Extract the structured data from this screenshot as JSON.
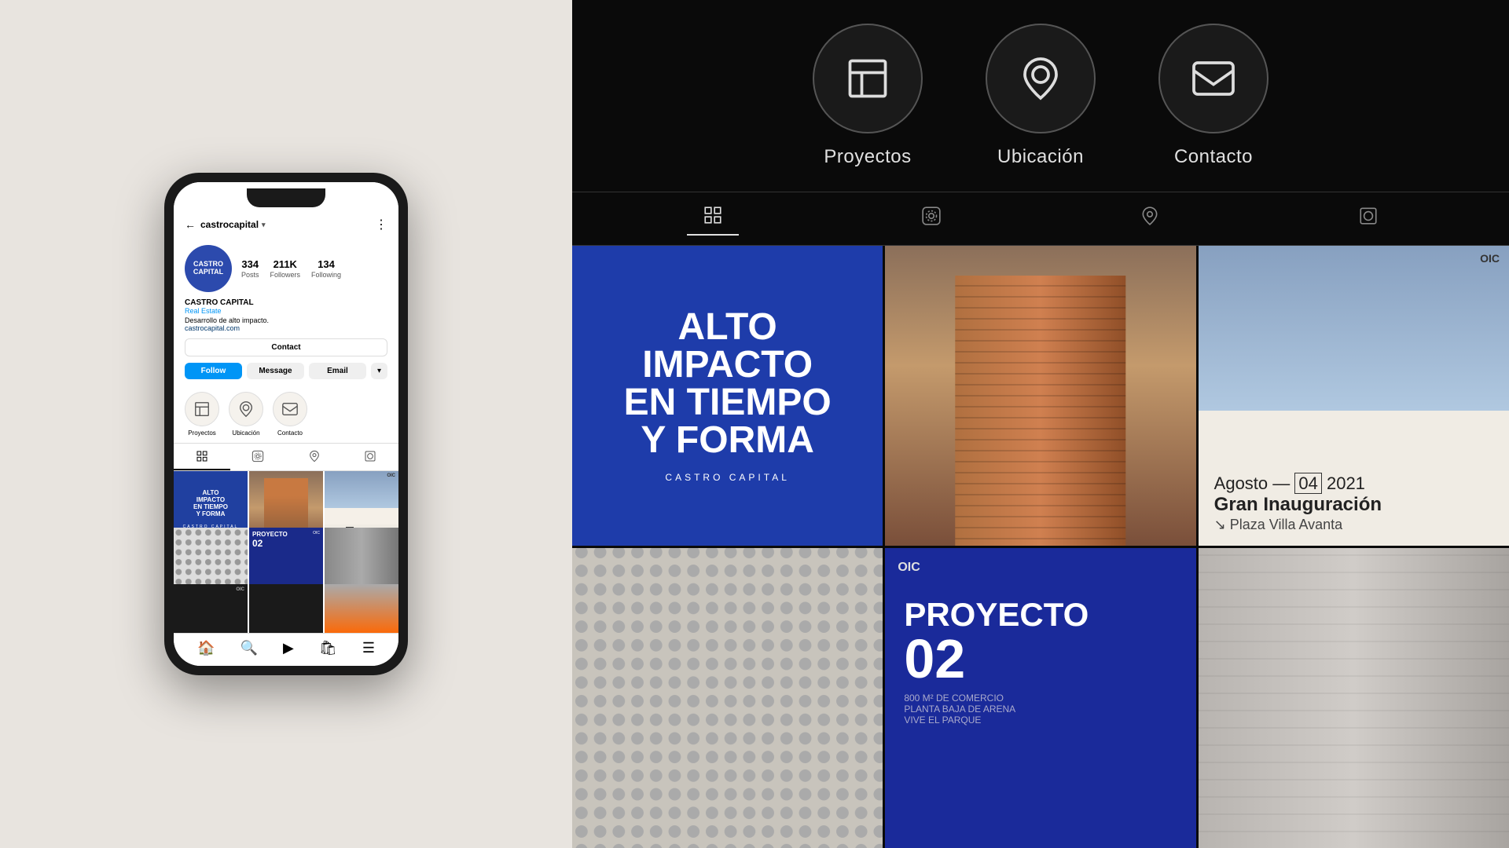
{
  "left_panel": {
    "background_color": "#e8e4df"
  },
  "phone": {
    "header": {
      "back_text": "castrocapital",
      "dropdown_symbol": "▾",
      "menu_symbol": "⋮"
    },
    "profile": {
      "avatar_text": "CASTRO\nCAPITAL",
      "stats": [
        {
          "value": "334",
          "label": "Posts"
        },
        {
          "value": "211K",
          "label": "Followers"
        },
        {
          "value": "134",
          "label": "Following"
        }
      ],
      "name": "CASTRO CAPITAL",
      "category": "Real Estate",
      "bio": "Desarrollo de alto impacto.",
      "link": "castrocapital.com"
    },
    "buttons": {
      "contact": "Contact",
      "follow": "Follow",
      "message": "Message",
      "email": "Email",
      "more": "▾"
    },
    "highlights": [
      {
        "label": "Proyectos",
        "icon": "🏠"
      },
      {
        "label": "Ubicación",
        "icon": "📍"
      },
      {
        "label": "Contacto",
        "icon": "✉"
      }
    ],
    "bottom_nav": [
      "🏠",
      "🔍",
      "▶",
      "🛍",
      "☰"
    ]
  },
  "right_panel": {
    "highlights": [
      {
        "label": "Proyectos"
      },
      {
        "label": "Ubicación"
      },
      {
        "label": "Contacto"
      }
    ],
    "grid_items": [
      {
        "type": "blue_text",
        "lines": [
          "ALTO",
          "IMPACTO",
          "EN TIEMPO",
          "Y FORMA"
        ],
        "brand": "CASTRO CAPITAL"
      },
      {
        "type": "building_photo"
      },
      {
        "type": "announcement",
        "date_prefix": "Agosto —",
        "date_boxed": "04",
        "year": "2021",
        "title": "Gran Inauguración",
        "subtitle": "↘ Plaza Villa Avanta"
      },
      {
        "type": "pattern"
      },
      {
        "type": "proyecto",
        "title": "PROYECTO",
        "number": "02",
        "logo": "OIC",
        "details": "800 M² DE COMERCIO\nPLANTA BAJA DE ARENA\nVIVE EL PARQUE"
      },
      {
        "type": "arch_photo"
      }
    ]
  }
}
